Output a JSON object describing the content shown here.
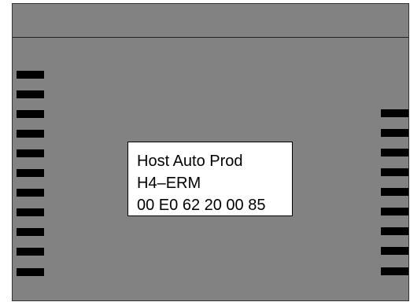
{
  "label": {
    "product": "Host Auto Prod",
    "model": "H4–ERM",
    "mac_address": "00 E0 62 20 00 85"
  },
  "pins": {
    "left_count": 11,
    "right_count": 9
  }
}
